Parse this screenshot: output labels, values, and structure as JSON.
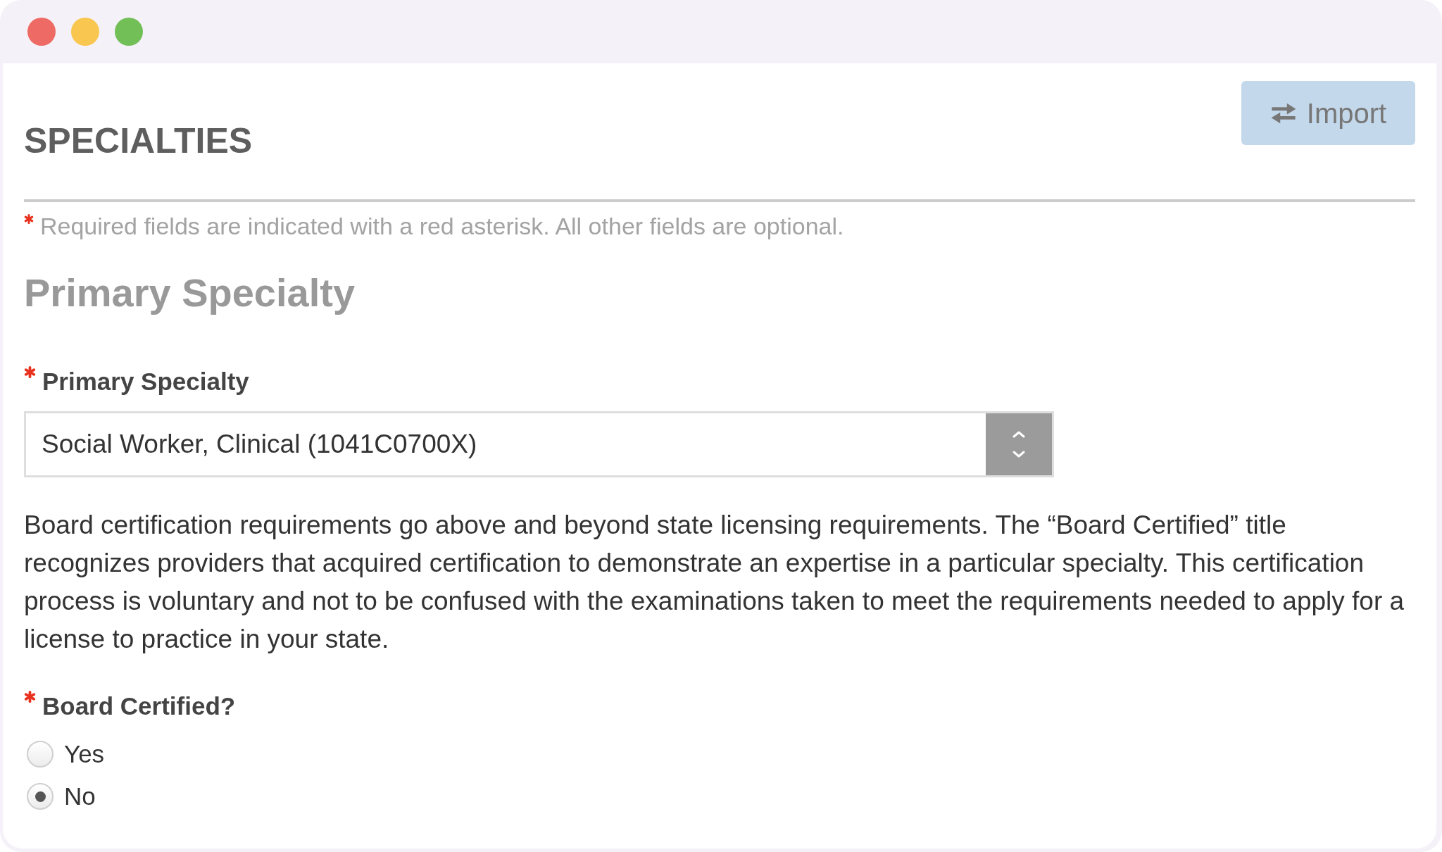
{
  "window": {
    "controls": [
      {
        "color": "#ee6a64"
      },
      {
        "color": "#f9c64f"
      },
      {
        "color": "#72bf58"
      }
    ]
  },
  "header": {
    "title": "SPECIALTIES",
    "import_button": {
      "label": "Import"
    }
  },
  "required_note": {
    "asterisk": true,
    "text": "Required fields are indicated with a red asterisk. All other fields are optional."
  },
  "section": {
    "title": "Primary Specialty",
    "fields": [
      {
        "kind": "select",
        "label": "Primary Specialty",
        "required": true,
        "value": "Social Worker, Clinical (1041C0700X)"
      },
      {
        "kind": "paragraph",
        "text": "Board certification requirements go above and beyond state licensing requirements. The “Board Certified” title recognizes providers that acquired certification to demonstrate an expertise in a particular specialty. This certification process is voluntary and not to be confused with the examinations taken to meet the requirements needed to apply for a license to practice in your state."
      },
      {
        "kind": "radio",
        "label": "Board Certified?",
        "required": true,
        "options": [
          {
            "label": "Yes",
            "selected": false
          },
          {
            "label": "No",
            "selected": true
          }
        ]
      }
    ]
  }
}
